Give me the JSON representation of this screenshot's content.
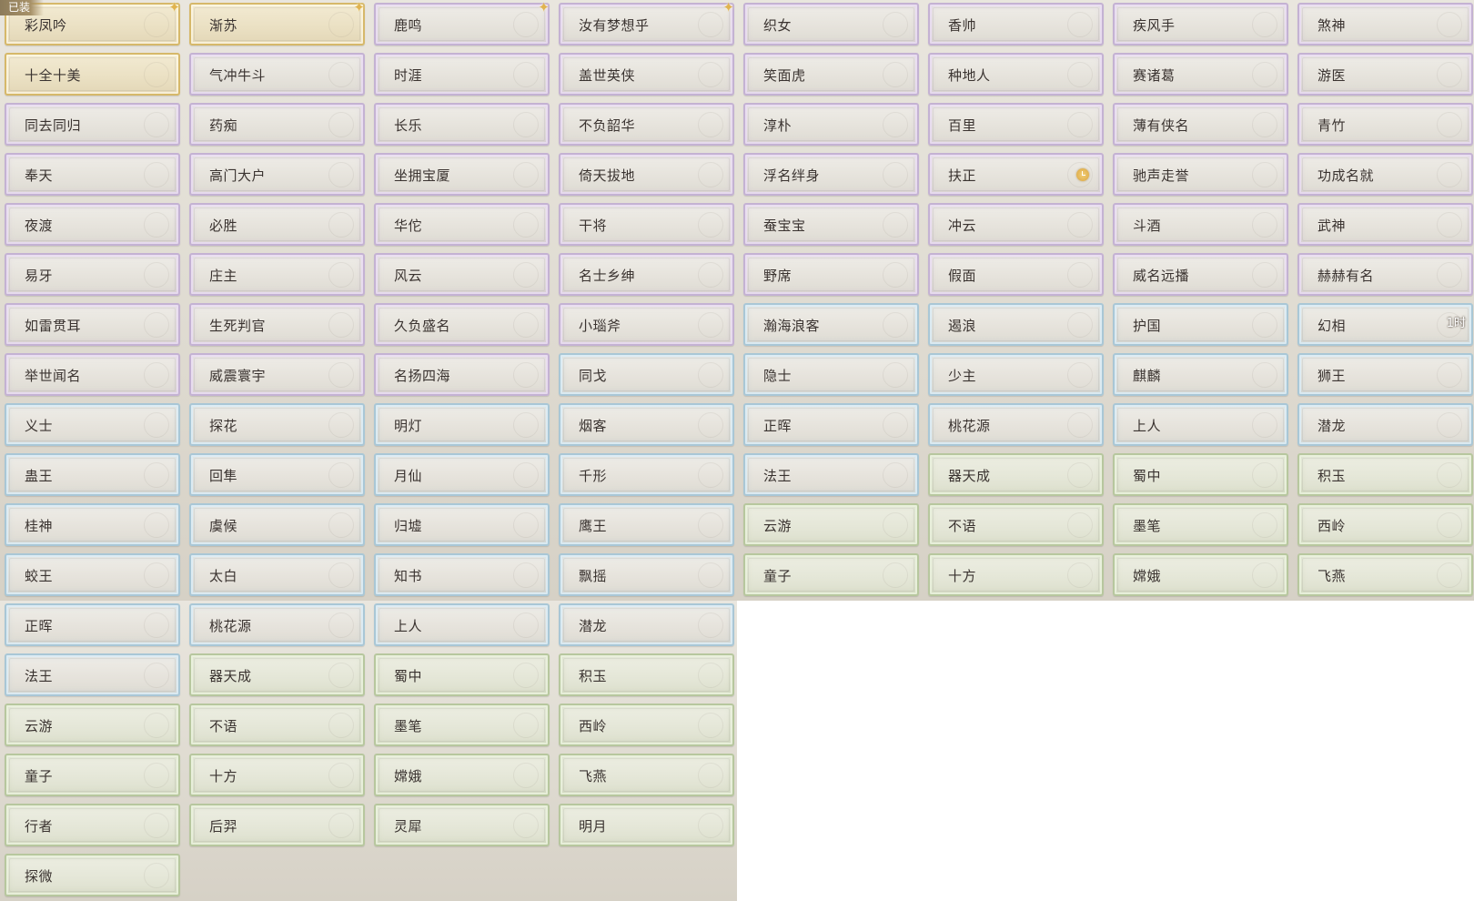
{
  "equipped_tag": "已装",
  "badges": {
    "duration": "1时"
  },
  "cards": [
    {
      "label": "彩凤吟",
      "tier": "gold",
      "equipped": true,
      "sparkle": true
    },
    {
      "label": "渐苏",
      "tier": "gold",
      "sparkle": true
    },
    {
      "label": "鹿鸣",
      "tier": "purple",
      "sparkle": true
    },
    {
      "label": "汝有梦想乎",
      "tier": "purple",
      "sparkle": true
    },
    {
      "label": "织女",
      "tier": "purple"
    },
    {
      "label": "香帅",
      "tier": "purple"
    },
    {
      "label": "疾风手",
      "tier": "purple"
    },
    {
      "label": "煞神",
      "tier": "purple"
    },
    {
      "label": "十全十美",
      "tier": "gold"
    },
    {
      "label": "气冲牛斗",
      "tier": "purple"
    },
    {
      "label": "时涯",
      "tier": "purple"
    },
    {
      "label": "盖世英侠",
      "tier": "purple"
    },
    {
      "label": "笑面虎",
      "tier": "purple"
    },
    {
      "label": "种地人",
      "tier": "purple"
    },
    {
      "label": "赛诸葛",
      "tier": "purple"
    },
    {
      "label": "游医",
      "tier": "purple"
    },
    {
      "label": "同去同归",
      "tier": "purple"
    },
    {
      "label": "药痴",
      "tier": "purple"
    },
    {
      "label": "长乐",
      "tier": "purple"
    },
    {
      "label": "不负韶华",
      "tier": "purple"
    },
    {
      "label": "淳朴",
      "tier": "purple"
    },
    {
      "label": "百里",
      "tier": "purple"
    },
    {
      "label": "薄有侠名",
      "tier": "purple"
    },
    {
      "label": "青竹",
      "tier": "purple"
    },
    {
      "label": "奉天",
      "tier": "purple"
    },
    {
      "label": "高门大户",
      "tier": "purple"
    },
    {
      "label": "坐拥宝厦",
      "tier": "purple"
    },
    {
      "label": "倚天拔地",
      "tier": "purple"
    },
    {
      "label": "浮名绊身",
      "tier": "purple"
    },
    {
      "label": "扶正",
      "tier": "purple",
      "timer": true
    },
    {
      "label": "驰声走誉",
      "tier": "purple"
    },
    {
      "label": "功成名就",
      "tier": "purple"
    },
    {
      "label": "夜渡",
      "tier": "purple"
    },
    {
      "label": "必胜",
      "tier": "purple"
    },
    {
      "label": "华佗",
      "tier": "purple"
    },
    {
      "label": "干将",
      "tier": "purple"
    },
    {
      "label": "蚕宝宝",
      "tier": "purple"
    },
    {
      "label": "冲云",
      "tier": "purple"
    },
    {
      "label": "斗酒",
      "tier": "purple"
    },
    {
      "label": "武神",
      "tier": "purple"
    },
    {
      "label": "易牙",
      "tier": "purple"
    },
    {
      "label": "庄主",
      "tier": "purple"
    },
    {
      "label": "风云",
      "tier": "purple"
    },
    {
      "label": "名士乡绅",
      "tier": "purple"
    },
    {
      "label": "野席",
      "tier": "purple"
    },
    {
      "label": "假面",
      "tier": "purple"
    },
    {
      "label": "威名远播",
      "tier": "purple"
    },
    {
      "label": "赫赫有名",
      "tier": "purple"
    },
    {
      "label": "如雷贯耳",
      "tier": "purple"
    },
    {
      "label": "生死判官",
      "tier": "purple"
    },
    {
      "label": "久负盛名",
      "tier": "purple"
    },
    {
      "label": "小瑙斧",
      "tier": "purple"
    },
    {
      "label": "瀚海浪客",
      "tier": "blue"
    },
    {
      "label": "遏浪",
      "tier": "blue"
    },
    {
      "label": "护国",
      "tier": "blue"
    },
    {
      "label": "幻相",
      "tier": "blue",
      "duration": true
    },
    {
      "label": "举世闻名",
      "tier": "purple"
    },
    {
      "label": "威震寰宇",
      "tier": "purple"
    },
    {
      "label": "名扬四海",
      "tier": "purple"
    },
    {
      "label": "同戈",
      "tier": "blue"
    },
    {
      "label": "隐士",
      "tier": "blue"
    },
    {
      "label": "少主",
      "tier": "blue"
    },
    {
      "label": "麒麟",
      "tier": "blue"
    },
    {
      "label": "狮王",
      "tier": "blue"
    },
    {
      "label": "义士",
      "tier": "blue"
    },
    {
      "label": "探花",
      "tier": "blue"
    },
    {
      "label": "明灯",
      "tier": "blue"
    },
    {
      "label": "烟客",
      "tier": "blue"
    },
    {
      "label": "正晖",
      "tier": "blue"
    },
    {
      "label": "桃花源",
      "tier": "blue"
    },
    {
      "label": "上人",
      "tier": "blue"
    },
    {
      "label": "潜龙",
      "tier": "blue"
    },
    {
      "label": "蛊王",
      "tier": "blue"
    },
    {
      "label": "回隼",
      "tier": "blue"
    },
    {
      "label": "月仙",
      "tier": "blue"
    },
    {
      "label": "千形",
      "tier": "blue"
    },
    {
      "label": "法王",
      "tier": "blue"
    },
    {
      "label": "器天成",
      "tier": "green"
    },
    {
      "label": "蜀中",
      "tier": "green"
    },
    {
      "label": "积玉",
      "tier": "green"
    },
    {
      "label": "桂神",
      "tier": "blue"
    },
    {
      "label": "虞候",
      "tier": "blue"
    },
    {
      "label": "归墟",
      "tier": "blue"
    },
    {
      "label": "鹰王",
      "tier": "blue"
    },
    {
      "label": "云游",
      "tier": "green"
    },
    {
      "label": "不语",
      "tier": "green"
    },
    {
      "label": "墨笔",
      "tier": "green"
    },
    {
      "label": "西岭",
      "tier": "green"
    },
    {
      "label": "蛟王",
      "tier": "blue"
    },
    {
      "label": "太白",
      "tier": "blue"
    },
    {
      "label": "知书",
      "tier": "blue"
    },
    {
      "label": "飘摇",
      "tier": "blue"
    },
    {
      "label": "童子",
      "tier": "green"
    },
    {
      "label": "十方",
      "tier": "green"
    },
    {
      "label": "嫦娥",
      "tier": "green"
    },
    {
      "label": "飞燕",
      "tier": "green"
    },
    {
      "label": "正晖",
      "tier": "blue"
    },
    {
      "label": "桃花源",
      "tier": "blue"
    },
    {
      "label": "上人",
      "tier": "blue"
    },
    {
      "label": "潜龙",
      "tier": "blue"
    },
    {
      "label": "法王",
      "tier": "blue"
    },
    {
      "label": "器天成",
      "tier": "green"
    },
    {
      "label": "蜀中",
      "tier": "green"
    },
    {
      "label": "积玉",
      "tier": "green"
    },
    {
      "label": "云游",
      "tier": "green"
    },
    {
      "label": "不语",
      "tier": "green"
    },
    {
      "label": "墨笔",
      "tier": "green"
    },
    {
      "label": "西岭",
      "tier": "green"
    },
    {
      "label": "童子",
      "tier": "green"
    },
    {
      "label": "十方",
      "tier": "green"
    },
    {
      "label": "嫦娥",
      "tier": "green"
    },
    {
      "label": "飞燕",
      "tier": "green"
    },
    {
      "label": "行者",
      "tier": "green"
    },
    {
      "label": "后羿",
      "tier": "green"
    },
    {
      "label": "灵犀",
      "tier": "green"
    },
    {
      "label": "明月",
      "tier": "green"
    },
    {
      "label": "探微",
      "tier": "green"
    }
  ]
}
